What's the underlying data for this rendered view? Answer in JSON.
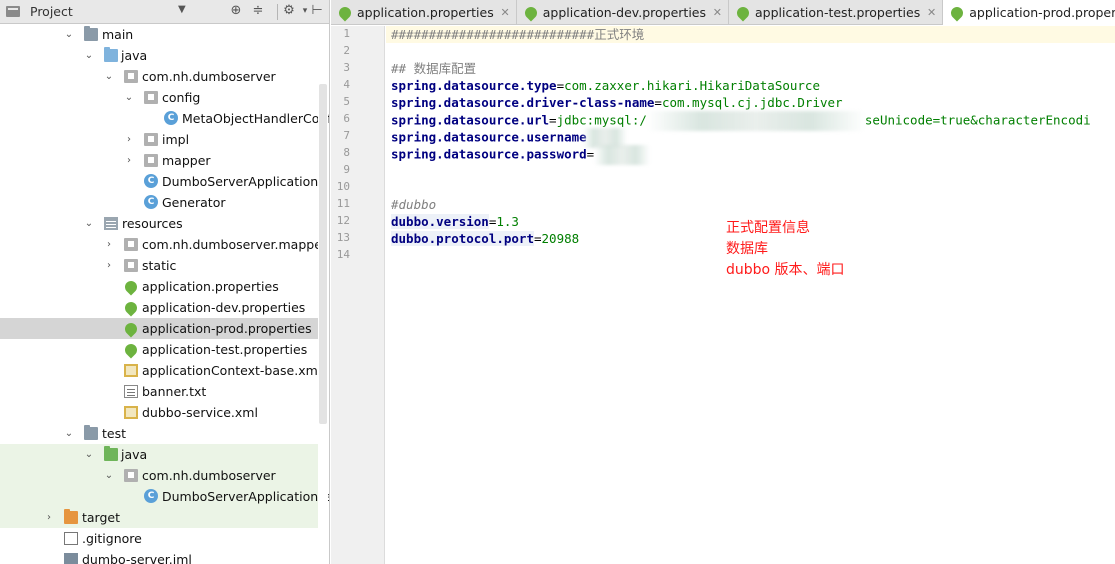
{
  "project_panel": {
    "title": "Project",
    "dropdown_icon": "chevron-down-icon",
    "toolbar_icons": [
      "locate-icon",
      "collapse-icon",
      "gear-icon",
      "hide-icon"
    ],
    "tree": [
      {
        "label": "main",
        "icon": "folder",
        "expanded": true
      },
      {
        "label": "java",
        "icon": "source-folder",
        "expanded": true
      },
      {
        "label": "com.nh.dumboserver",
        "icon": "package",
        "expanded": true
      },
      {
        "label": "config",
        "icon": "package",
        "expanded": true
      },
      {
        "label": "MetaObjectHandlerConfig",
        "icon": "class"
      },
      {
        "label": "impl",
        "icon": "package",
        "expanded": false
      },
      {
        "label": "mapper",
        "icon": "package",
        "expanded": false
      },
      {
        "label": "DumboServerApplication",
        "icon": "class"
      },
      {
        "label": "Generator",
        "icon": "class"
      },
      {
        "label": "resources",
        "icon": "resources-folder",
        "expanded": true
      },
      {
        "label": "com.nh.dumboserver.mapper",
        "icon": "package",
        "expanded": false
      },
      {
        "label": "static",
        "icon": "package",
        "expanded": false
      },
      {
        "label": "application.properties",
        "icon": "spring-properties"
      },
      {
        "label": "application-dev.properties",
        "icon": "spring-properties"
      },
      {
        "label": "application-prod.properties",
        "icon": "spring-properties",
        "selected": true
      },
      {
        "label": "application-test.properties",
        "icon": "spring-properties"
      },
      {
        "label": "applicationContext-base.xml",
        "icon": "xml"
      },
      {
        "label": "banner.txt",
        "icon": "text"
      },
      {
        "label": "dubbo-service.xml",
        "icon": "xml"
      },
      {
        "label": "test",
        "icon": "folder",
        "expanded": true
      },
      {
        "label": "java",
        "icon": "test-folder",
        "expanded": true
      },
      {
        "label": "com.nh.dumboserver",
        "icon": "package",
        "expanded": true
      },
      {
        "label": "DumboServerApplicationTests",
        "icon": "class"
      },
      {
        "label": "target",
        "icon": "excluded-folder",
        "expanded": false
      },
      {
        "label": ".gitignore",
        "icon": "gitignore"
      },
      {
        "label": "dumbo-server.iml",
        "icon": "iml"
      }
    ]
  },
  "tabs": [
    {
      "label": "application.properties",
      "active": false
    },
    {
      "label": "application-dev.properties",
      "active": false
    },
    {
      "label": "application-test.properties",
      "active": false
    },
    {
      "label": "application-prod.properties",
      "active": true
    }
  ],
  "editor": {
    "line_numbers": [
      "1",
      "2",
      "3",
      "4",
      "5",
      "6",
      "7",
      "8",
      "9",
      "10",
      "11",
      "12",
      "13",
      "14"
    ],
    "lines": {
      "l1": "###########################正式环境",
      "l3": "## 数据库配置",
      "l4_key": "spring.datasource.type",
      "l4_val": "com.zaxxer.hikari.HikariDataSource",
      "l5_key": "spring.datasource.driver-class-name",
      "l5_val": "com.mysql.cj.jdbc.Driver",
      "l6_key": "spring.datasource.url",
      "l6_val_a": "jdbc:mysql:/",
      "l6_val_b": "seUnicode=true&characterEncodi",
      "l7_key": "spring.datasource.username",
      "l8_key": "spring.datasource.password",
      "l11": "#dubbo",
      "l12_key": "dubbo.version",
      "l12_val": "1.3",
      "l13_key": "dubbo.protocol.port",
      "l13_val": "20988",
      "eq": "="
    },
    "annotation": [
      "正式配置信息",
      "数据库",
      "dubbo 版本、端口"
    ]
  },
  "colors": {
    "comment": "#808080",
    "key": "#000080",
    "value": "#007f00",
    "annotation": "#ff1a1a",
    "selection": "#d5d5d5"
  }
}
